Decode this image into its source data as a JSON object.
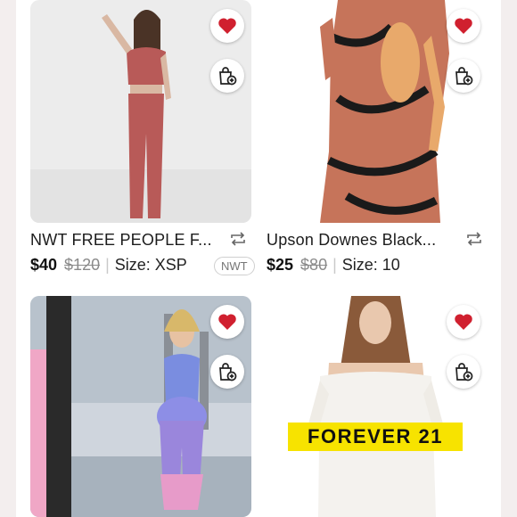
{
  "listings": [
    {
      "title": "NWT FREE PEOPLE F...",
      "price": "$40",
      "original_price": "$120",
      "size": "Size: XSP",
      "badge": "NWT",
      "liked": true
    },
    {
      "title": "Upson Downes Black...",
      "price": "$25",
      "original_price": "$80",
      "size": "Size: 10",
      "badge": "",
      "liked": true
    },
    {
      "liked": true
    },
    {
      "liked": true,
      "image_text": "FOREVER 21"
    }
  ],
  "colors": {
    "heart": "#d0202f",
    "background": "#f3eeee",
    "separator": "#c9c9c9"
  },
  "icons": {
    "favorite": "heart-icon",
    "bundle": "shopping-bag-plus-icon",
    "share": "share-arrows-icon"
  }
}
